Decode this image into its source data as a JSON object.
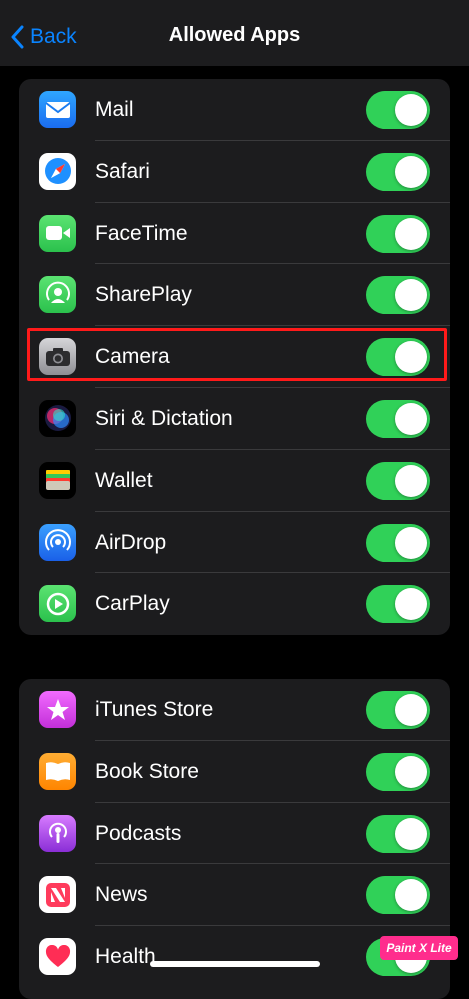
{
  "nav": {
    "back_label": "Back",
    "title": "Allowed Apps"
  },
  "groups": [
    {
      "items": [
        {
          "label": "Mail",
          "icon": "mail-icon",
          "color": "#1a8cff",
          "on": true
        },
        {
          "label": "Safari",
          "icon": "safari-icon",
          "color": "#ffffff",
          "on": true
        },
        {
          "label": "FaceTime",
          "icon": "facetime-icon",
          "color": "#34c759",
          "on": true
        },
        {
          "label": "SharePlay",
          "icon": "shareplay-icon",
          "color": "#34c759",
          "on": true
        },
        {
          "label": "Camera",
          "icon": "camera-icon",
          "color": "#8e8e93",
          "on": true
        },
        {
          "label": "Siri & Dictation",
          "icon": "siri-icon",
          "color": "#000000",
          "on": true
        },
        {
          "label": "Wallet",
          "icon": "wallet-icon",
          "color": "#000000",
          "on": true
        },
        {
          "label": "AirDrop",
          "icon": "airdrop-icon",
          "color": "#1a7cff",
          "on": true
        },
        {
          "label": "CarPlay",
          "icon": "carplay-icon",
          "color": "#34c759",
          "on": true
        }
      ]
    },
    {
      "items": [
        {
          "label": "iTunes Store",
          "icon": "star-icon",
          "color": "#e043e8",
          "on": true
        },
        {
          "label": "Book Store",
          "icon": "book-icon",
          "color": "#ff9500",
          "on": true
        },
        {
          "label": "Podcasts",
          "icon": "podcasts-icon",
          "color": "#b44ad8",
          "on": true
        },
        {
          "label": "News",
          "icon": "news-icon",
          "color": "#ffffff",
          "on": true
        },
        {
          "label": "Health",
          "icon": "heart-icon",
          "color": "#ffffff",
          "on": true
        }
      ]
    }
  ],
  "highlight_item": "Camera",
  "watermark": "Paint X Lite",
  "colors": {
    "accent": "#0a84ff",
    "toggle_on": "#30d158",
    "highlight": "#ff1a1a"
  }
}
